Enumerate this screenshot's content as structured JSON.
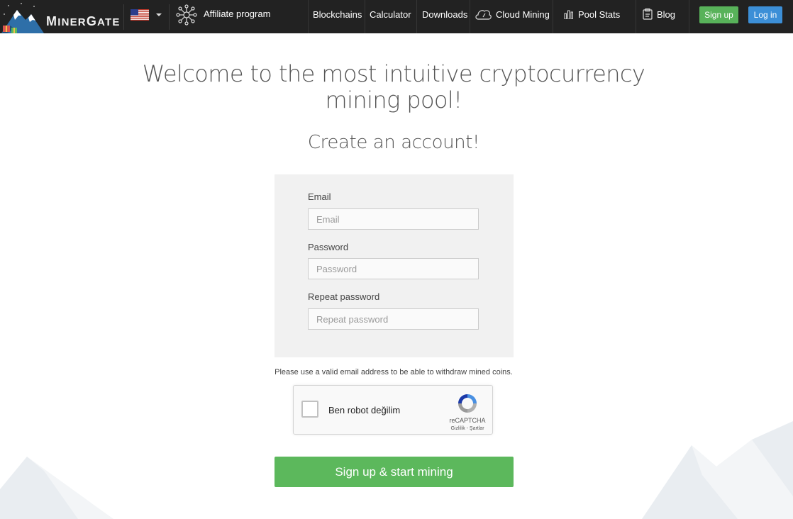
{
  "brand": {
    "name": "MinerGate"
  },
  "nav": {
    "language": "en-US",
    "affiliate": "Affiliate program",
    "links": {
      "blockchains": "Blockchains",
      "calculator": "Calculator",
      "downloads": "Downloads",
      "cloud_mining": "Cloud Mining",
      "pool_stats": "Pool Stats",
      "blog": "Blog"
    },
    "signup": "Sign up",
    "login": "Log in"
  },
  "hero": {
    "headline_line1": "Welcome to the most intuitive cryptocurrency",
    "headline_line2": "mining pool!",
    "subheading": "Create an account!"
  },
  "form": {
    "email_label": "Email",
    "email_placeholder": "Email",
    "password_label": "Password",
    "password_placeholder": "Password",
    "repeat_label": "Repeat password",
    "repeat_placeholder": "Repeat password",
    "note": "Please use a valid email address to be able to withdraw mined coins.",
    "submit": "Sign up & start mining"
  },
  "captcha": {
    "checkbox_label": "Ben robot değilim",
    "brand": "reCAPTCHA",
    "links": "Gizlilik - Şartlar"
  },
  "colors": {
    "navbar": "#222222",
    "signup_green": "#58b25a",
    "login_blue": "#3c8fd7",
    "submit_green": "#5cb85c"
  }
}
